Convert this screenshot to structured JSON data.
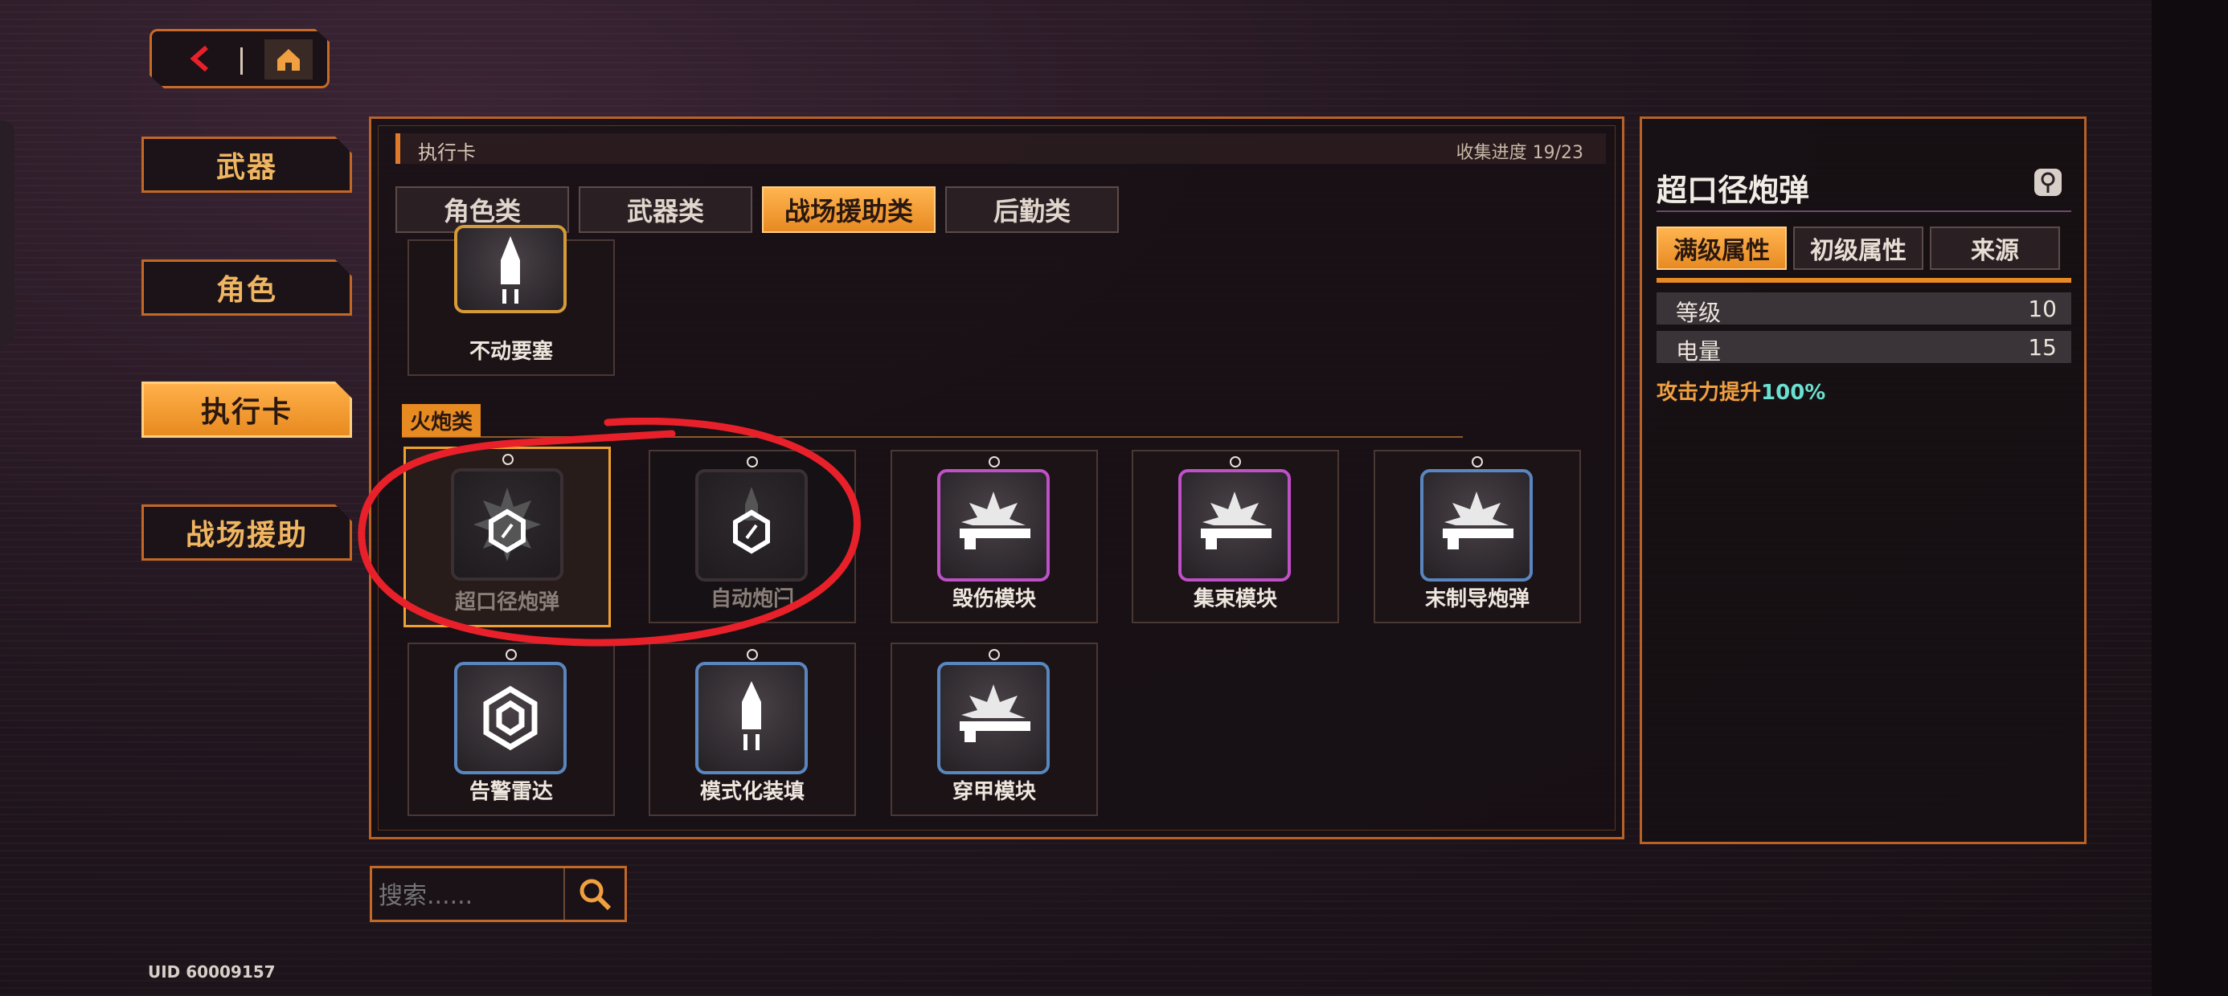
{
  "topbar": {
    "back_icon": "back-arrow-icon",
    "home_icon": "home-icon"
  },
  "nav": [
    {
      "label": "武器",
      "active": false
    },
    {
      "label": "角色",
      "active": false
    },
    {
      "label": "执行卡",
      "active": true
    },
    {
      "label": "战场援助",
      "active": false
    }
  ],
  "uid": "UID 60009157",
  "panel": {
    "header": "执行卡",
    "progress": "收集进度 19/23",
    "tabs": [
      {
        "label": "角色类",
        "active": false
      },
      {
        "label": "武器类",
        "active": false
      },
      {
        "label": "战场援助类",
        "active": true
      },
      {
        "label": "后勤类",
        "active": false
      }
    ],
    "top_card": {
      "label": "不动要塞",
      "icon": "rocket-icon"
    },
    "section": "火炮类",
    "cards": [
      {
        "label": "超口径炮弹",
        "icon": "locked-cannon-icon",
        "state": "selected-locked"
      },
      {
        "label": "自动炮闩",
        "icon": "locked-rocket-icon",
        "state": "locked"
      },
      {
        "label": "毁伤模块",
        "icon": "cannon-burst-icon",
        "state": "owned"
      },
      {
        "label": "集束模块",
        "icon": "cannon-burst-icon",
        "state": "owned"
      },
      {
        "label": "末制导炮弹",
        "icon": "cannon-burst-icon",
        "state": "owned"
      },
      {
        "label": "告警雷达",
        "icon": "radar-hex-icon",
        "state": "owned"
      },
      {
        "label": "模式化装填",
        "icon": "rocket-icon",
        "state": "owned"
      },
      {
        "label": "穿甲模块",
        "icon": "cannon-burst-icon",
        "state": "owned"
      }
    ]
  },
  "detail": {
    "title": "超口径炮弹",
    "tabs": [
      {
        "label": "满级属性",
        "active": true
      },
      {
        "label": "初级属性",
        "active": false
      },
      {
        "label": "来源",
        "active": false
      }
    ],
    "rows": [
      {
        "key": "等级",
        "value": "10"
      },
      {
        "key": "电量",
        "value": "15"
      }
    ],
    "bonus_label": "攻击力提升",
    "bonus_value": "100%"
  },
  "search": {
    "placeholder": "搜索......"
  },
  "colors": {
    "accent": "#e88a22",
    "border": "#c46826",
    "annotation": "#e8202a"
  }
}
